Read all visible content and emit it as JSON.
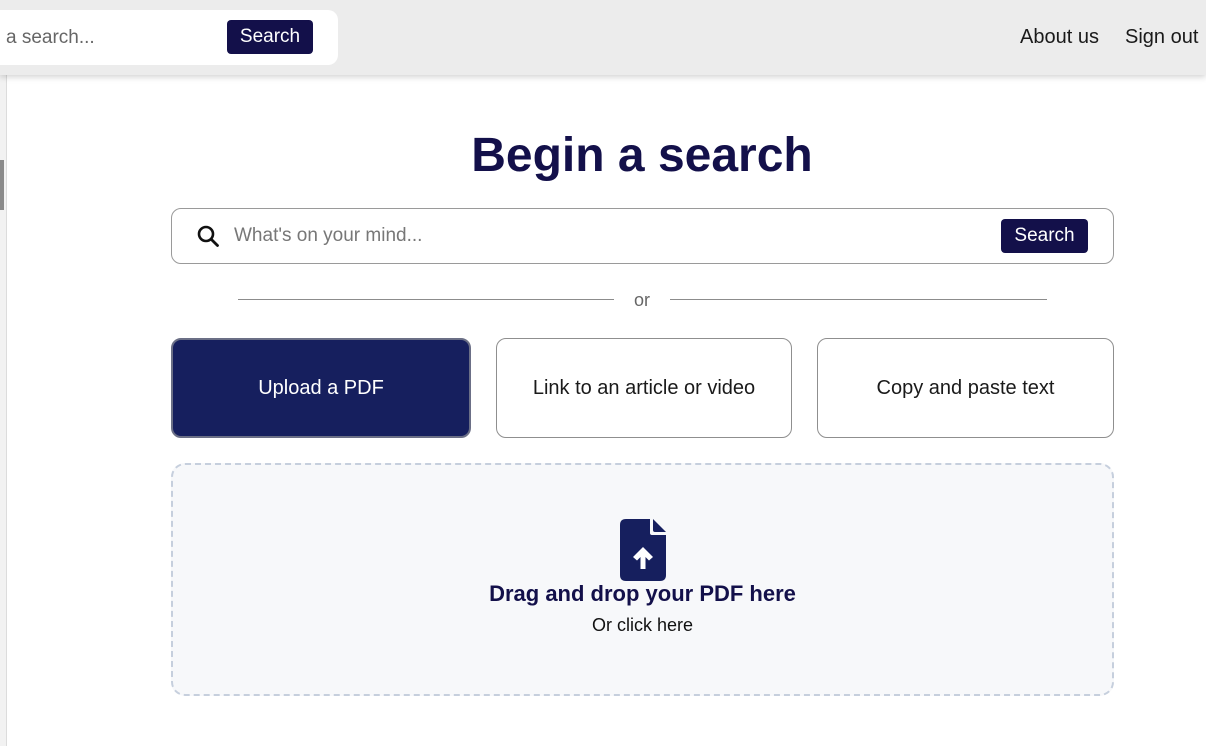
{
  "header": {
    "search_placeholder": "a search...",
    "search_button": "Search",
    "nav": {
      "about": "About us",
      "sign_out": "Sign out"
    }
  },
  "main": {
    "title": "Begin a search",
    "search": {
      "placeholder": "What's on your mind...",
      "button": "Search",
      "icon": "search-icon"
    },
    "divider_text": "or",
    "options": [
      {
        "label": "Upload a PDF",
        "active": true
      },
      {
        "label": "Link to an article or video",
        "active": false
      },
      {
        "label": "Copy and paste text",
        "active": false
      }
    ],
    "dropzone": {
      "icon": "file-upload-icon",
      "title": "Drag and drop your PDF here",
      "subtitle": "Or click here"
    }
  },
  "colors": {
    "brand_dark": "#13104a",
    "active_card": "#161f5e",
    "dropzone_bg": "#f7f8fa",
    "dropzone_border": "#c6cfdd"
  }
}
